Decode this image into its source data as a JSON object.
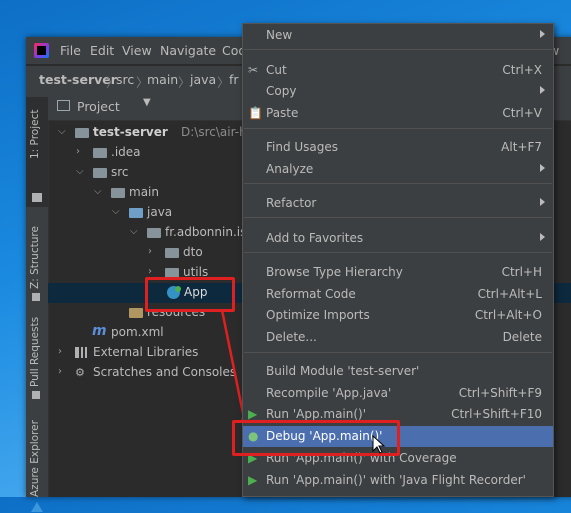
{
  "menubar": {
    "file": "File",
    "edit": "Edit",
    "view": "View",
    "navigate": "Navigate",
    "code": "Cod",
    "right": "w"
  },
  "navbar": {
    "project": "test-server",
    "src": "src",
    "main": "main",
    "java": "java",
    "fr": "fr"
  },
  "sidebar": {
    "project_tab": "1: Project",
    "structure_tab": "Z: Structure",
    "pull_tab": "Pull Requests",
    "azure_tab": "Azure Explorer"
  },
  "project_panel": {
    "title": "Project"
  },
  "tree": [
    {
      "label": "test-server",
      "sub": "D:\\src\\air-https-"
    },
    {
      "label": ".idea"
    },
    {
      "label": "src"
    },
    {
      "label": "main"
    },
    {
      "label": "java"
    },
    {
      "label": "fr.adbonnin.iss"
    },
    {
      "label": "dto"
    },
    {
      "label": "utils"
    },
    {
      "label": "App"
    },
    {
      "label": "resources"
    },
    {
      "label": "pom.xml"
    },
    {
      "label": "External Libraries"
    },
    {
      "label": "Scratches and Consoles"
    }
  ],
  "context_menu": {
    "new": "New",
    "cut": "Cut",
    "cut_sc": "Ctrl+X",
    "copy": "Copy",
    "paste": "Paste",
    "paste_sc": "Ctrl+V",
    "find_usages": "Find Usages",
    "find_usages_sc": "Alt+F7",
    "analyze": "Analyze",
    "refactor": "Refactor",
    "add_favorites": "Add to Favorites",
    "browse_hierarchy": "Browse Type Hierarchy",
    "browse_hierarchy_sc": "Ctrl+H",
    "reformat": "Reformat Code",
    "reformat_sc": "Ctrl+Alt+L",
    "optimize": "Optimize Imports",
    "optimize_sc": "Ctrl+Alt+O",
    "delete": "Delete...",
    "delete_sc": "Delete",
    "build_module": "Build Module 'test-server'",
    "recompile": "Recompile 'App.java'",
    "recompile_sc": "Ctrl+Shift+F9",
    "run": "Run 'App.main()'",
    "run_sc": "Ctrl+Shift+F10",
    "debug": "Debug 'App.main()'",
    "run_coverage": "Run 'App.main()' with Coverage",
    "run_jfr": "Run 'App.main()' with 'Java Flight Recorder'"
  },
  "colors": {
    "highlight": "#4b6eaf",
    "annotation": "#e02020",
    "run_green": "#4caf50"
  }
}
